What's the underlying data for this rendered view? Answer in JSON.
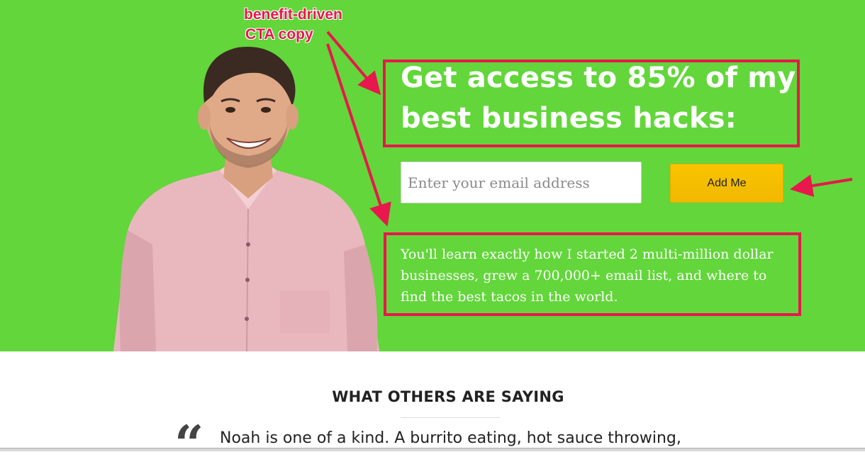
{
  "annotation": {
    "lines": [
      "benefit-driven",
      "CTA copy"
    ],
    "color": "#e8174d"
  },
  "hero": {
    "background": "#62d63a",
    "headline": "Get access to 85% of my best business hacks:",
    "email_placeholder": "Enter your email address",
    "button_label": "Add Me",
    "description": "You'll learn exactly how I started 2 multi-million dollar businesses, grew a 700,000+ email list, and where to find the best tacos in the world."
  },
  "testimonials": {
    "heading": "WHAT OTHERS ARE SAYING",
    "quote_mark": "“",
    "quote": "Noah is one of a kind. A burrito eating, hot sauce throwing,"
  },
  "icons": {
    "person": "person-photo-icon",
    "arrow": "annotation-arrow-icon"
  }
}
